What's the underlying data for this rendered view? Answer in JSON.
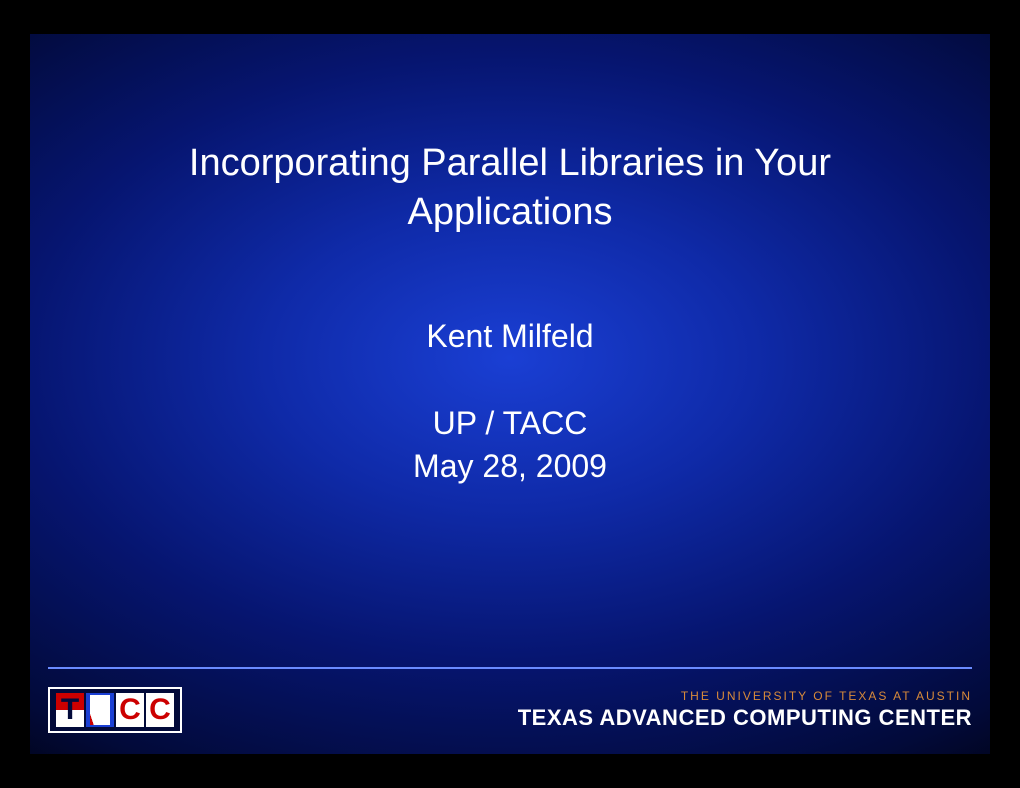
{
  "slide": {
    "title": "Incorporating Parallel Libraries in Your Applications",
    "author": "Kent Milfeld",
    "org": "UP / TACC",
    "date": "May 28, 2009"
  },
  "footer": {
    "logo_left_text": "TACC",
    "logo_right_line1": "THE UNIVERSITY OF TEXAS AT AUSTIN",
    "logo_right_line2": "TEXAS ADVANCED COMPUTING CENTER"
  }
}
